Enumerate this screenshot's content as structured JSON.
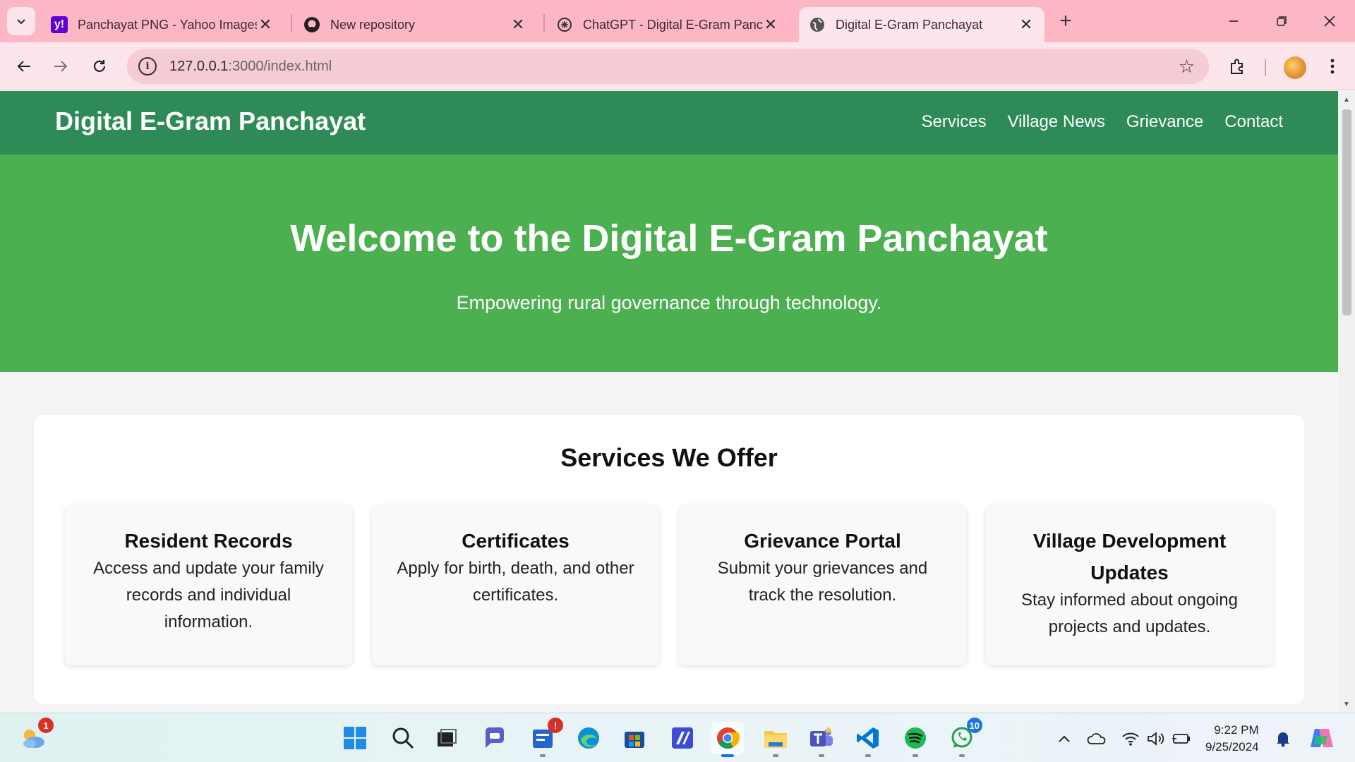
{
  "browser": {
    "tabs": [
      {
        "title": "Panchayat PNG - Yahoo Images",
        "icon": "yahoo-icon",
        "active": false
      },
      {
        "title": "New repository",
        "icon": "github-icon",
        "active": false
      },
      {
        "title": "ChatGPT - Digital E-Gram Panchayat",
        "icon": "chatgpt-icon",
        "active": false
      },
      {
        "title": "Digital E-Gram Panchayat",
        "icon": "globe-icon",
        "active": true
      }
    ],
    "url_host": "127.0.0.1",
    "url_rest": ":3000/index.html"
  },
  "site": {
    "title": "Digital E-Gram Panchayat",
    "nav": [
      "Services",
      "Village News",
      "Grievance",
      "Contact"
    ],
    "hero_title": "Welcome to the Digital E-Gram Panchayat",
    "hero_subtitle": "Empowering rural governance through technology.",
    "services_heading": "Services We Offer",
    "services": [
      {
        "title": "Resident Records",
        "description": "Access and update your family records and individual information."
      },
      {
        "title": "Certificates",
        "description": "Apply for birth, death, and other certificates."
      },
      {
        "title": "Grievance Portal",
        "description": "Submit your grievances and track the resolution."
      },
      {
        "title": "Village Development Updates",
        "description": "Stay informed about ongoing projects and updates."
      }
    ],
    "colors": {
      "header": "#2e8b57",
      "hero": "#4caf50"
    }
  },
  "taskbar": {
    "weather_badge": "1",
    "todo_badge": "!",
    "whatsapp_badge": "10",
    "time": "9:22 PM",
    "date": "9/25/2024"
  }
}
